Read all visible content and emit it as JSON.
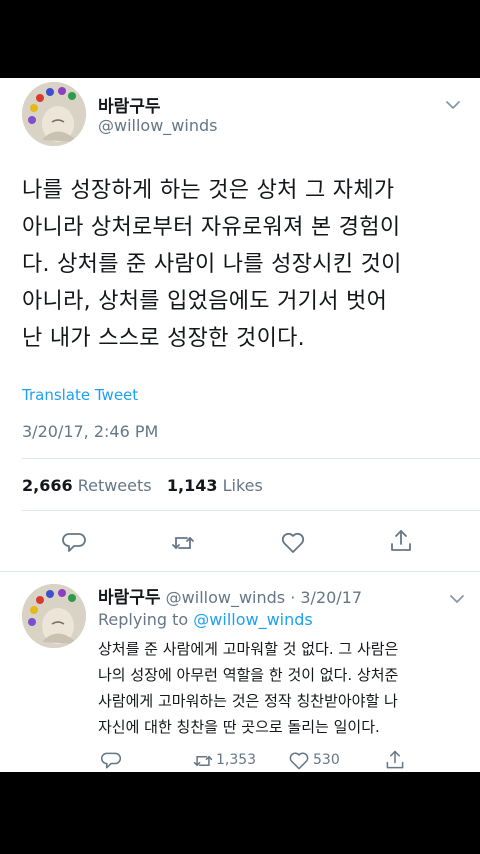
{
  "tweet": {
    "display_name": "바람구두",
    "handle": "@willow_winds",
    "text_lines": [
      "나를 성장하게 하는 것은 상처 그 자체가",
      "아니라 상처로부터 자유로워져 본 경험이",
      "다. 상처를 준 사람이 나를 성장시킨 것이",
      "아니라, 상처를 입었음에도 거기서 벗어",
      "난 내가 스스로 성장한 것이다."
    ],
    "translate_label": "Translate Tweet",
    "timestamp": "3/20/17, 2:46 PM",
    "retweets_count": "2,666",
    "retweets_label": "Retweets",
    "likes_count": "1,143",
    "likes_label": "Likes"
  },
  "reply": {
    "display_name": "바람구두",
    "handle_date": "@willow_winds · 3/20/17",
    "replying_prefix": "Replying to",
    "replying_handle": "@willow_winds",
    "text_lines": [
      "상처를 준 사람에게 고마워할 것 없다. 그 사람은",
      "나의 성장에 아무런 역할을 한 것이 없다. 상처준",
      "사람에게 고마워하는 것은 정작 칭찬받아야할 나",
      "자신에 대한 칭찬을 딴 곳으로 돌리는 일이다."
    ],
    "retweet_count": "1,353",
    "like_count": "530"
  },
  "colors": {
    "accent": "#1da1f2",
    "text": "#14171a",
    "secondary": "#657786",
    "divider": "#e1e8ed"
  },
  "icons": {
    "reply": "reply-icon",
    "retweet": "retweet-icon",
    "like": "heart-icon",
    "share": "share-icon",
    "more": "chevron-down-icon"
  }
}
